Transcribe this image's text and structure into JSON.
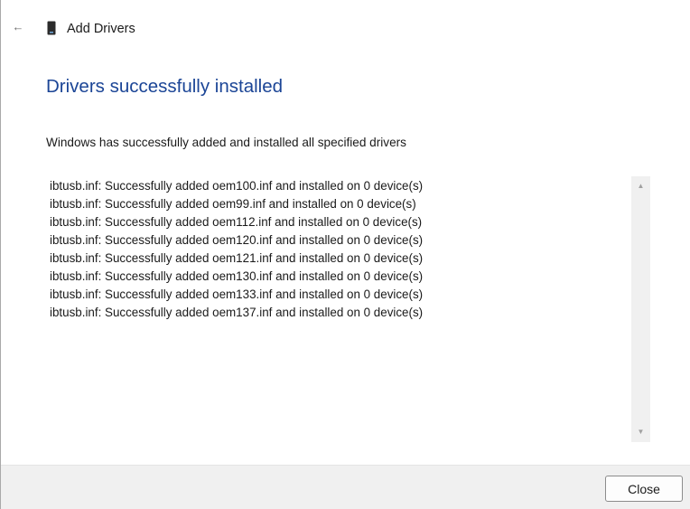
{
  "header": {
    "back_icon": "back-arrow-icon",
    "app_icon": "driver-device-icon",
    "title": "Add Drivers"
  },
  "main": {
    "heading": "Drivers successfully installed",
    "summary": "Windows has successfully added and installed all specified drivers",
    "log_lines": [
      "ibtusb.inf: Successfully added oem100.inf and installed on 0 device(s)",
      "ibtusb.inf: Successfully added oem99.inf and installed on 0 device(s)",
      "ibtusb.inf: Successfully added oem112.inf and installed on 0 device(s)",
      "ibtusb.inf: Successfully added oem120.inf and installed on 0 device(s)",
      "ibtusb.inf: Successfully added oem121.inf and installed on 0 device(s)",
      "ibtusb.inf: Successfully added oem130.inf and installed on 0 device(s)",
      "ibtusb.inf: Successfully added oem133.inf and installed on 0 device(s)",
      "ibtusb.inf: Successfully added oem137.inf and installed on 0 device(s)"
    ]
  },
  "footer": {
    "close_label": "Close"
  },
  "colors": {
    "heading": "#1b4596",
    "footer_bg": "#f0f0f0",
    "scrollbar_bg": "#f0f0f0"
  }
}
